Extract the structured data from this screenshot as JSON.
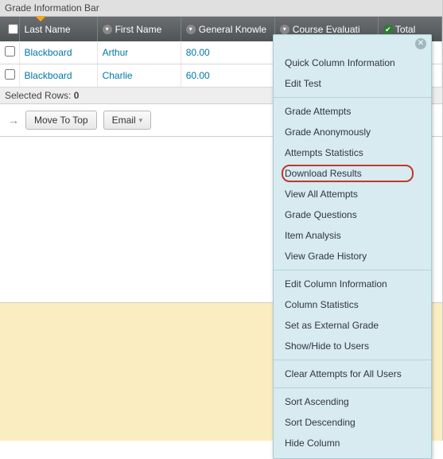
{
  "infoBar": {
    "title": "Grade Information Bar"
  },
  "columns": {
    "c1": "Last Name",
    "c2": "First Name",
    "c3": "General Knowle",
    "c4": "Course Evaluati",
    "c5": "Total"
  },
  "rows": [
    {
      "last": "Blackboard",
      "first": "Arthur",
      "g1": "80.00"
    },
    {
      "last": "Blackboard",
      "first": "Charlie",
      "g1": "60.00"
    }
  ],
  "selectedRows": {
    "label": "Selected Rows:",
    "count": "0"
  },
  "actions": {
    "moveTop": "Move To Top",
    "email": "Email"
  },
  "menu": {
    "group1": [
      "Quick Column Information",
      "Edit Test"
    ],
    "group2": [
      "Grade Attempts",
      "Grade Anonymously",
      "Attempts Statistics",
      "Download Results",
      "View All Attempts",
      "Grade Questions",
      "Item Analysis",
      "View Grade History"
    ],
    "group3": [
      "Edit Column Information",
      "Column Statistics",
      "Set as External Grade",
      "Show/Hide to Users"
    ],
    "group4": [
      "Clear Attempts for All Users"
    ],
    "group5": [
      "Sort Ascending",
      "Sort Descending",
      "Hide Column"
    ],
    "highlightIndex": 3
  }
}
